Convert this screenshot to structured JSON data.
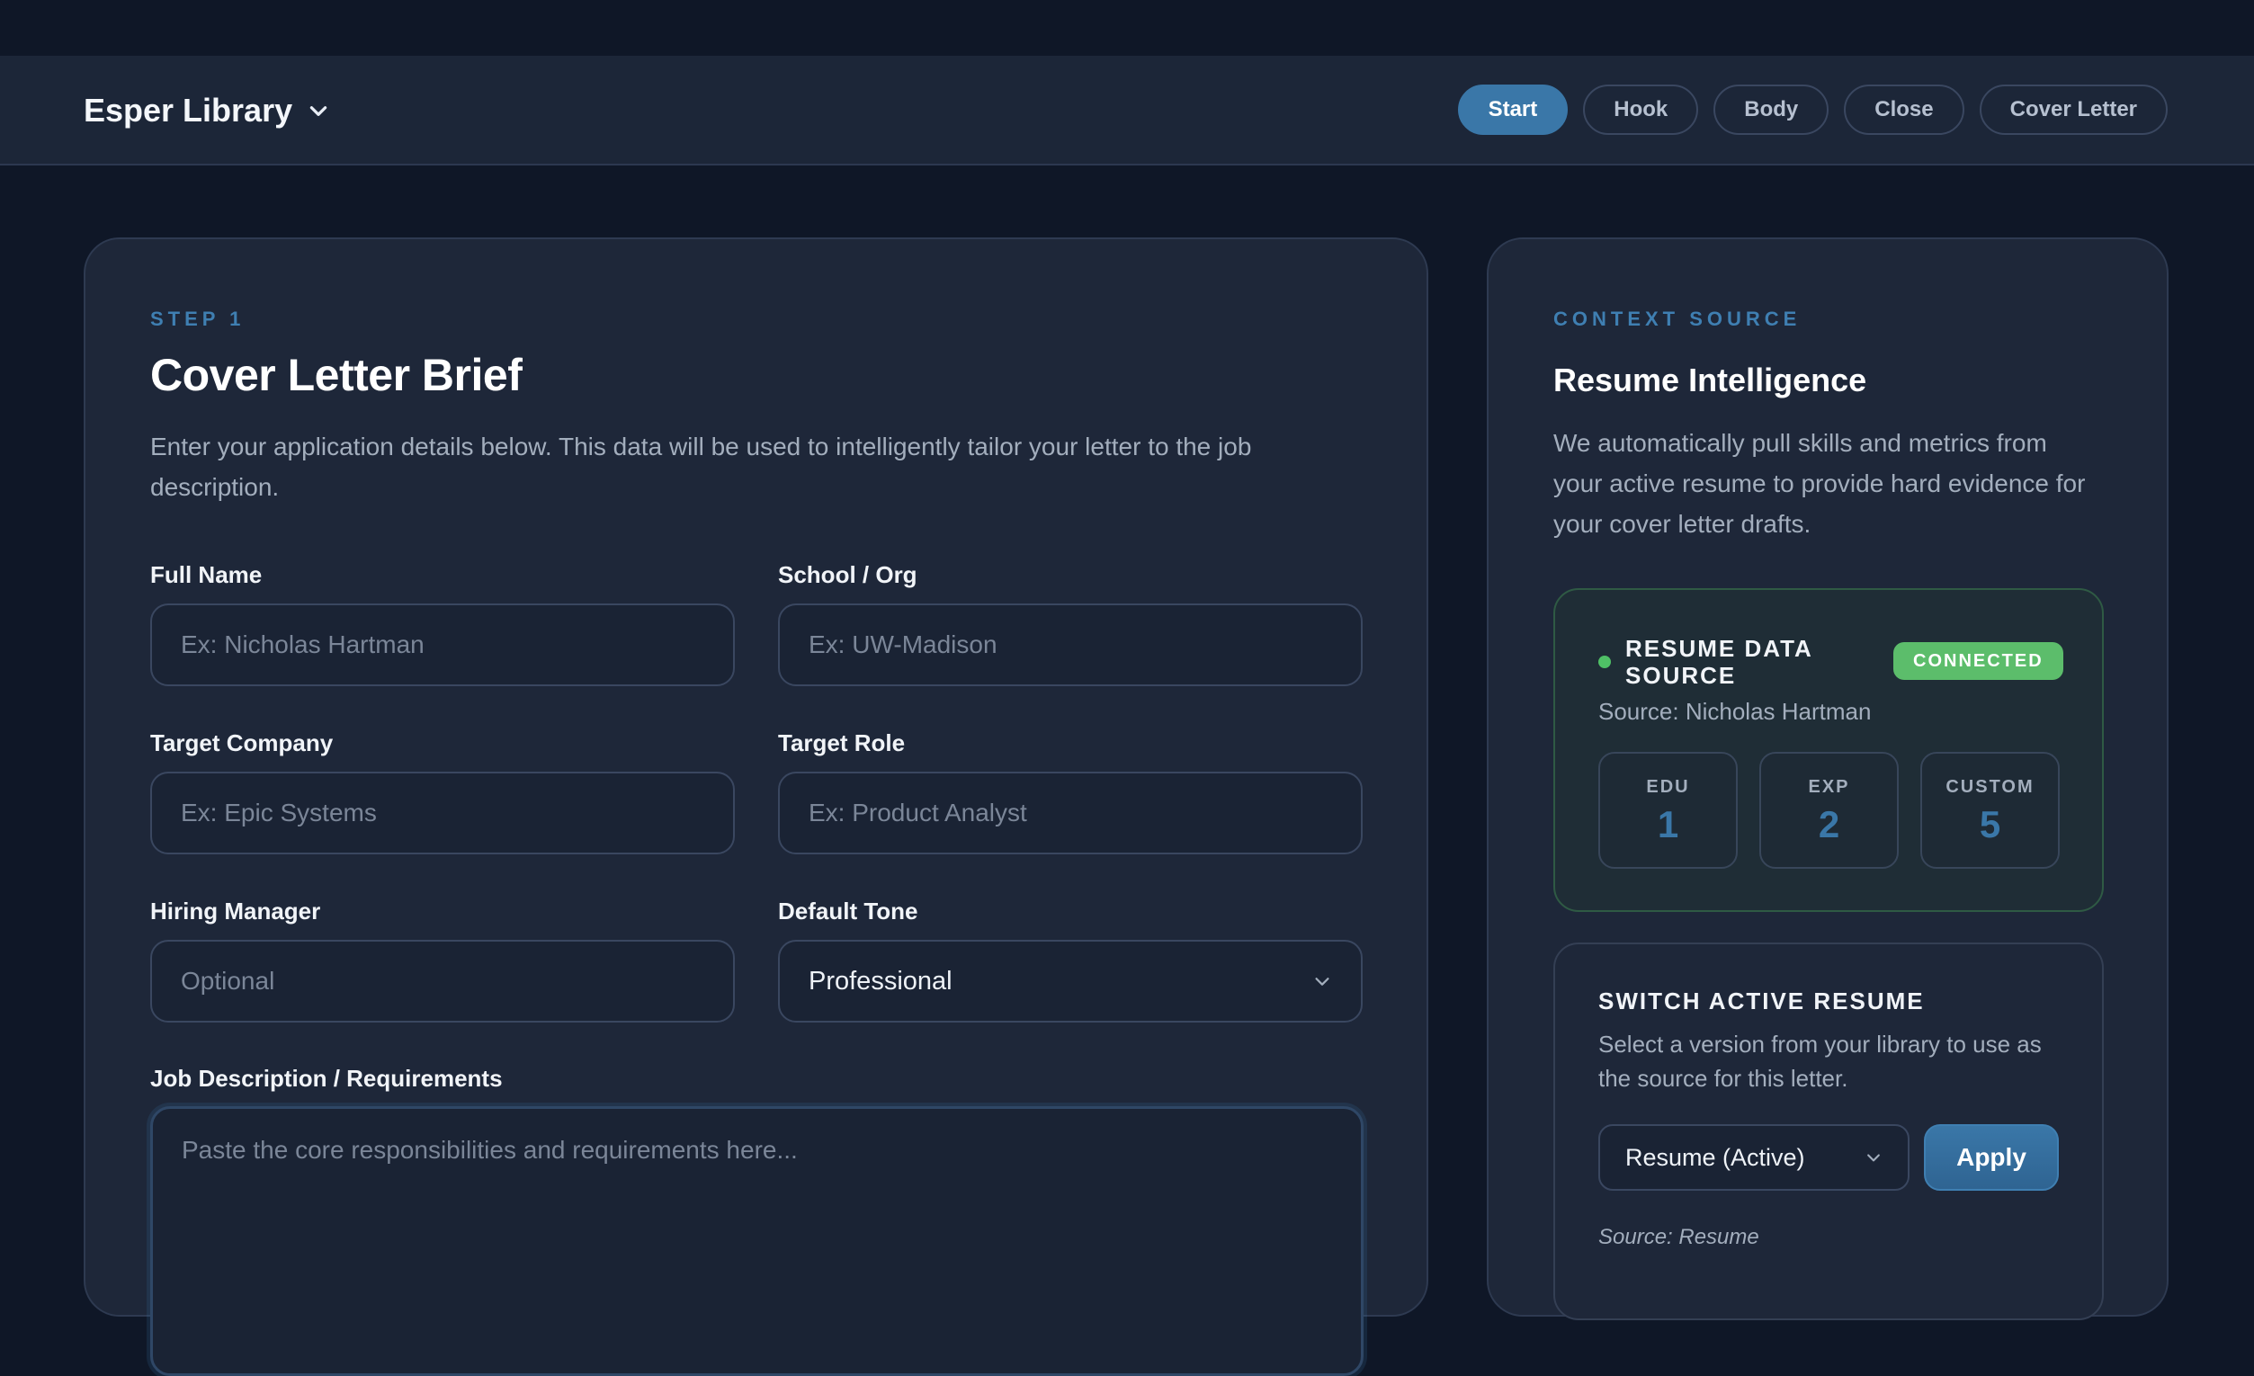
{
  "header": {
    "brand": "Esper Library",
    "tabs": [
      {
        "label": "Start",
        "active": true
      },
      {
        "label": "Hook",
        "active": false
      },
      {
        "label": "Body",
        "active": false
      },
      {
        "label": "Close",
        "active": false
      },
      {
        "label": "Cover Letter",
        "active": false
      }
    ]
  },
  "brief": {
    "step": "STEP 1",
    "title": "Cover Letter Brief",
    "description": "Enter your application details below. This data will be used to intelligently tailor your letter to the job description.",
    "fields": {
      "full_name": {
        "label": "Full Name",
        "placeholder": "Ex: Nicholas Hartman",
        "value": ""
      },
      "school": {
        "label": "School / Org",
        "placeholder": "Ex: UW-Madison",
        "value": ""
      },
      "company": {
        "label": "Target Company",
        "placeholder": "Ex: Epic Systems",
        "value": ""
      },
      "role": {
        "label": "Target Role",
        "placeholder": "Ex: Product Analyst",
        "value": ""
      },
      "manager": {
        "label": "Hiring Manager",
        "placeholder": "Optional",
        "value": ""
      },
      "tone": {
        "label": "Default Tone",
        "value": "Professional"
      },
      "job_description": {
        "label": "Job Description / Requirements",
        "placeholder": "Paste the core responsibilities and requirements here..."
      }
    }
  },
  "context": {
    "eyebrow": "CONTEXT SOURCE",
    "title": "Resume Intelligence",
    "description": "We automatically pull skills and metrics from your active resume to provide hard evidence for your cover letter drafts.",
    "source": {
      "title": "RESUME DATA SOURCE",
      "status": "CONNECTED",
      "subtitle": "Source: Nicholas Hartman",
      "stats": [
        {
          "label": "EDU",
          "value": "1"
        },
        {
          "label": "EXP",
          "value": "2"
        },
        {
          "label": "CUSTOM",
          "value": "5"
        }
      ]
    },
    "switch": {
      "title": "SWITCH ACTIVE RESUME",
      "description": "Select a version from your library to use as the source for this letter.",
      "selected": "Resume (Active)",
      "apply_label": "Apply",
      "source_note": "Source: Resume"
    }
  },
  "colors": {
    "accent": "#3a77a8",
    "connected": "#5cbd6b",
    "background": "#0f1727",
    "card": "#1e2739"
  },
  "icons": {
    "brand_chevron": "chevron-down-icon",
    "select_chevron": "chevron-down-icon",
    "status_dot": "status-dot-icon"
  }
}
